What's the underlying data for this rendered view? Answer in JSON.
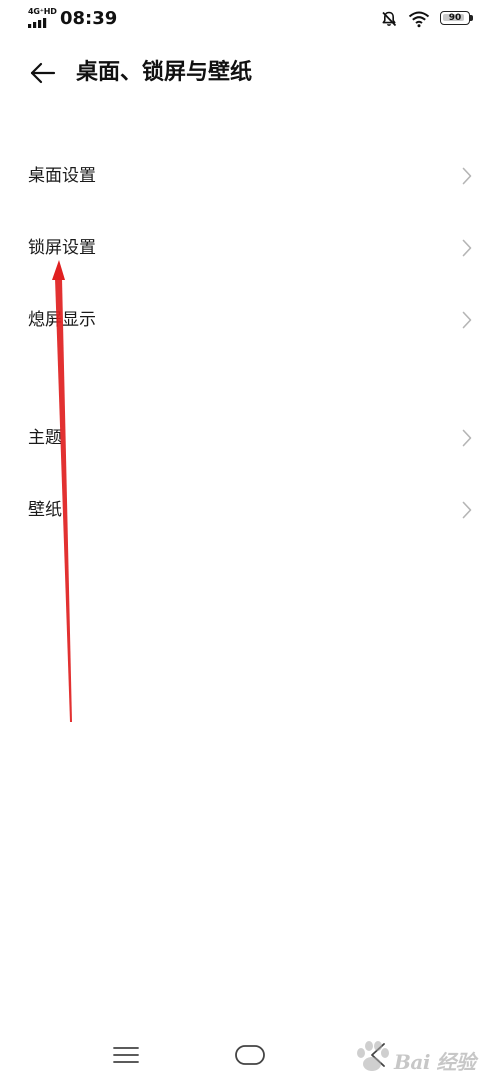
{
  "status_bar": {
    "network_label": "4G⁺HD",
    "time": "08:39",
    "battery_level": "90",
    "battery_fraction": 0.9,
    "icons": [
      "signal-icon",
      "silent-bell-icon",
      "wifi-icon",
      "battery-icon"
    ]
  },
  "header": {
    "title": "桌面、锁屏与壁纸",
    "back_icon": "back-arrow-icon"
  },
  "settings": {
    "group1": [
      {
        "label": "桌面设置"
      },
      {
        "label": "锁屏设置"
      },
      {
        "label": "熄屏显示"
      }
    ],
    "group2": [
      {
        "label": "主题"
      },
      {
        "label": "壁纸"
      }
    ]
  },
  "navigation": {
    "icons": [
      "menu-icon",
      "home-icon",
      "back-icon"
    ]
  },
  "watermark": {
    "text": "Bai 经验"
  },
  "colors": {
    "background": "#ffffff",
    "text": "#1a1a1a",
    "chevron": "#b5b5b5",
    "annotation_arrow": "#e02020"
  }
}
